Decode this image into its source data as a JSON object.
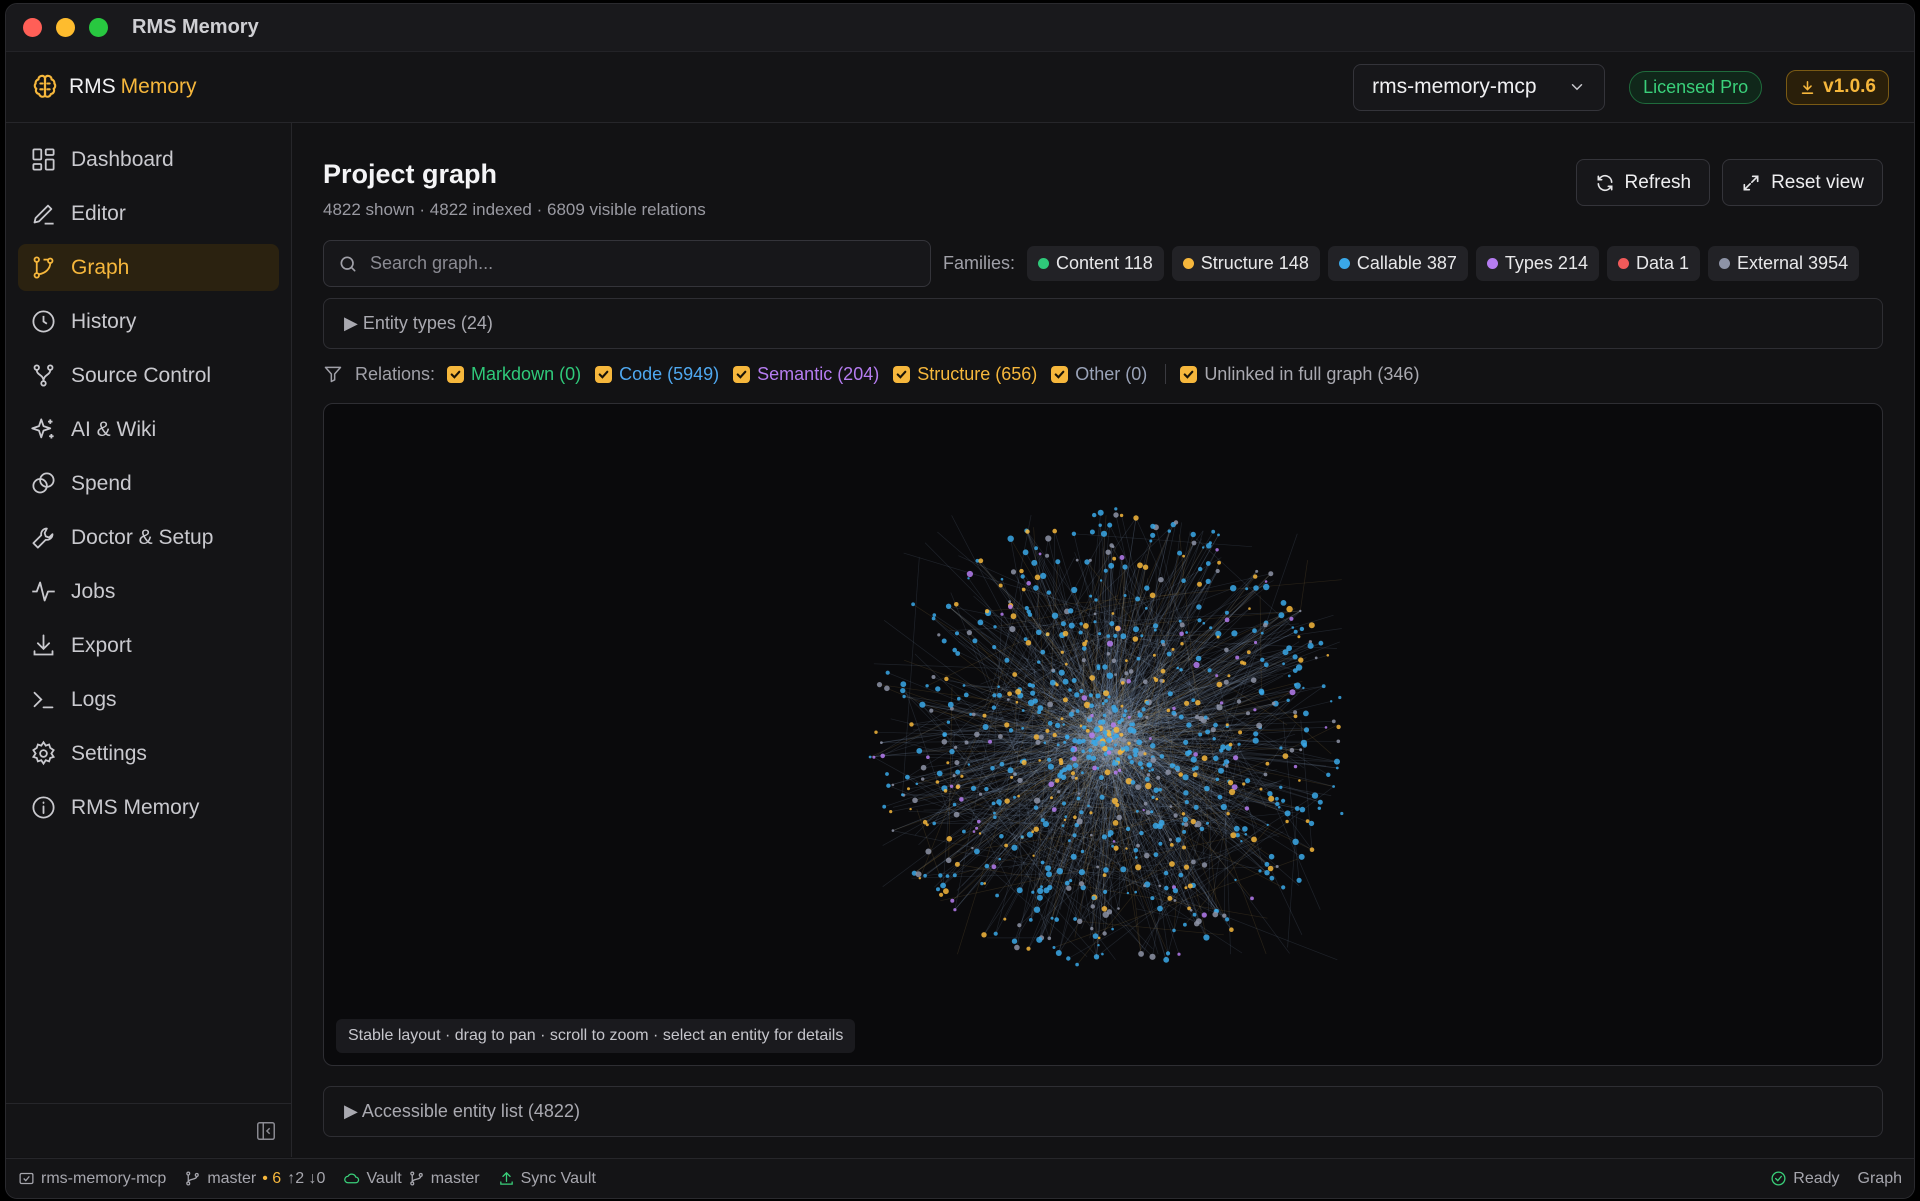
{
  "window": {
    "title": "RMS Memory"
  },
  "header": {
    "brand_primary": "RMS",
    "brand_accent": "Memory",
    "project": "rms-memory-mcp",
    "license_badge": "Licensed Pro",
    "version_badge": "v1.0.6"
  },
  "sidebar": {
    "items": [
      {
        "label": "Dashboard",
        "icon": "dashboard-icon"
      },
      {
        "label": "Editor",
        "icon": "pencil-icon"
      },
      {
        "label": "Graph",
        "icon": "graph-icon",
        "active": true
      },
      {
        "label": "History",
        "icon": "clock-icon"
      },
      {
        "label": "Source Control",
        "icon": "git-branch-icon"
      },
      {
        "label": "AI & Wiki",
        "icon": "sparkle-icon"
      },
      {
        "label": "Spend",
        "icon": "coins-icon"
      },
      {
        "label": "Doctor & Setup",
        "icon": "wrench-icon"
      },
      {
        "label": "Jobs",
        "icon": "activity-icon"
      },
      {
        "label": "Export",
        "icon": "download-icon"
      },
      {
        "label": "Logs",
        "icon": "terminal-icon"
      },
      {
        "label": "Settings",
        "icon": "gear-icon"
      },
      {
        "label": "RMS Memory",
        "icon": "info-icon"
      }
    ]
  },
  "page": {
    "title": "Project graph",
    "subtitle": "4822 shown · 4822 indexed · 6809 visible relations",
    "refresh_label": "Refresh",
    "reset_label": "Reset view"
  },
  "search": {
    "placeholder": "Search graph..."
  },
  "families": {
    "label": "Families:",
    "items": [
      {
        "label": "Content 118",
        "color": "#2fc97a"
      },
      {
        "label": "Structure 148",
        "color": "#f6b73c"
      },
      {
        "label": "Callable 387",
        "color": "#3aa8e8"
      },
      {
        "label": "Types 214",
        "color": "#b57cf0"
      },
      {
        "label": "Data 1",
        "color": "#f05a5a"
      },
      {
        "label": "External 3954",
        "color": "#8d93a6"
      }
    ]
  },
  "entity_types": {
    "label": "▶ Entity types (24)"
  },
  "relations": {
    "label": "Relations:",
    "items": [
      {
        "label": "Markdown (0)",
        "color": "#2fc97a"
      },
      {
        "label": "Code (5949)",
        "color": "#4fa8f0"
      },
      {
        "label": "Semantic (204)",
        "color": "#b57cf0"
      },
      {
        "label": "Structure (656)",
        "color": "#f6b73c"
      },
      {
        "label": "Other (0)",
        "color": "#9aa3b8"
      }
    ],
    "unlinked_label": "Unlinked in full graph (346)"
  },
  "graph": {
    "hint": "Stable layout · drag to pan · scroll to zoom · select an entity for details",
    "node_colors": [
      "#3aa8e8",
      "#f6b73c",
      "#b57cf0",
      "#8d93a6"
    ]
  },
  "entity_list": {
    "label": "▶ Accessible entity list (4822)"
  },
  "statusbar": {
    "project": "rms-memory-mcp",
    "branch": "master",
    "changes": "• 6",
    "sync_counts": "↑2 ↓0",
    "vault": "Vault",
    "vault_branch": "master",
    "sync_vault": "Sync Vault",
    "status": "Ready",
    "view": "Graph"
  }
}
